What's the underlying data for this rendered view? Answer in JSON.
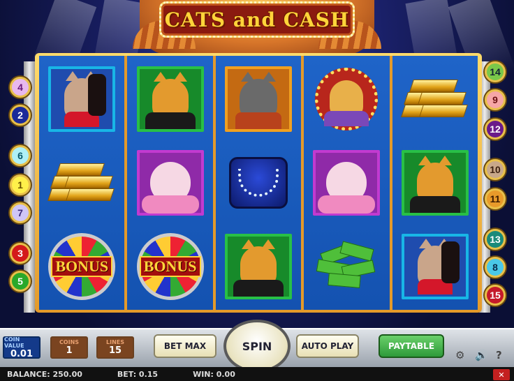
{
  "game": {
    "title": "CATS and CASH"
  },
  "reels": [
    [
      "Cat in Red",
      "Gold Bars",
      "BONUS"
    ],
    [
      "Tabby Cat",
      "Pink Cat",
      "BONUS"
    ],
    [
      "Grey Cat",
      "Necklace",
      "Tabby Cat"
    ],
    [
      "Boss Cat",
      "Pink Cat",
      "Cash"
    ],
    [
      "Gold Bars",
      "Tabby Cat",
      "Cat in Red"
    ]
  ],
  "bonus_label": "BONUS",
  "paylines_left": [
    "4",
    "2",
    "6",
    "1",
    "7",
    "3",
    "5"
  ],
  "paylines_right": [
    "14",
    "9",
    "12",
    "10",
    "11",
    "13",
    "8",
    "15"
  ],
  "controls": {
    "coin_value_label": "COIN VALUE",
    "coin_value": "0.01",
    "coins_label": "COINS",
    "coins": "1",
    "lines_label": "LINES",
    "lines": "15",
    "bet_max": "BET MAX",
    "spin": "SPIN",
    "auto_play": "AUTO PLAY",
    "paytable": "PAYTABLE"
  },
  "status": {
    "balance": "BALANCE: 250.00",
    "bet": "BET: 0.15",
    "win": "WIN: 0.00"
  },
  "colors": {
    "reel_blue": "#1a5ac0",
    "frame_gold": "#e9a22f",
    "paytable_green": "#2e9a3a"
  }
}
